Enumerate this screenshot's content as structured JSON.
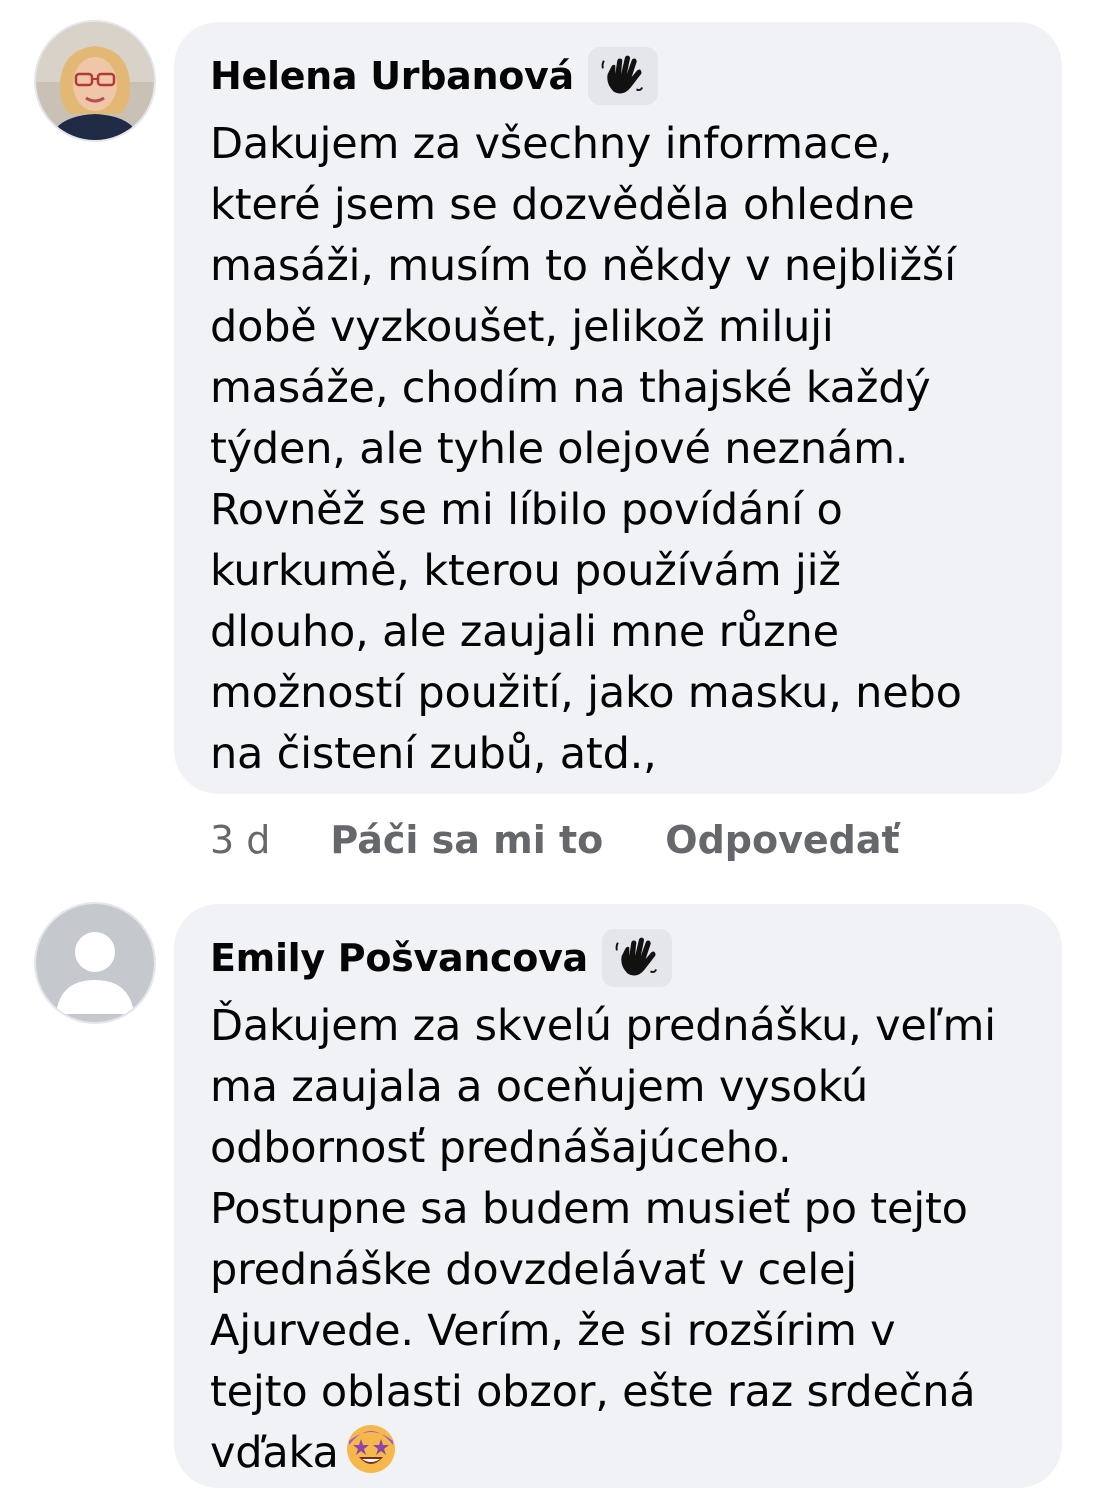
{
  "comments": [
    {
      "author": "Helena Urbanová",
      "badge_icon": "waving-hand-icon",
      "avatar": "profile-photo",
      "text": "Dakujem za všechny informace,\nkteré jsem se dozvěděla ohledne\nmasáži, musím to někdy v nejbližší\ndobě  vyzkoušet, jelikož miluji\nmasáže, chodím na thajské každý\ntýden, ale tyhle olejové neznám.\nRovněž se mi líbilo povídání o\nkurkumě, kterou používám již\ndlouho, ale zaujali mne různe\nmožností použití, jako masku, nebo\nna čistení zubů, atd.,",
      "time": "3 d",
      "like_label": "Páči sa mi to",
      "reply_label": "Odpovedať"
    },
    {
      "author": "Emily Pošvancova",
      "badge_icon": "waving-hand-icon",
      "avatar": "default-avatar",
      "text": "Ďakujem za skvelú prednášku, veľmi\nma zaujala a oceňujem vysokú\nodbornosť prednášajúceho.\nPostupne sa budem musieť po tejto\nprednáške dovzdelávať v celej\nAjurvede. Verím, že si rozšírim v\ntejto oblasti obzor, ešte raz srdečná\nvďaka",
      "emoji_icon": "star-struck-emoji-icon"
    }
  ],
  "colors": {
    "bubble": "#f0f2f5",
    "meta": "#65676b",
    "text": "#050505"
  }
}
